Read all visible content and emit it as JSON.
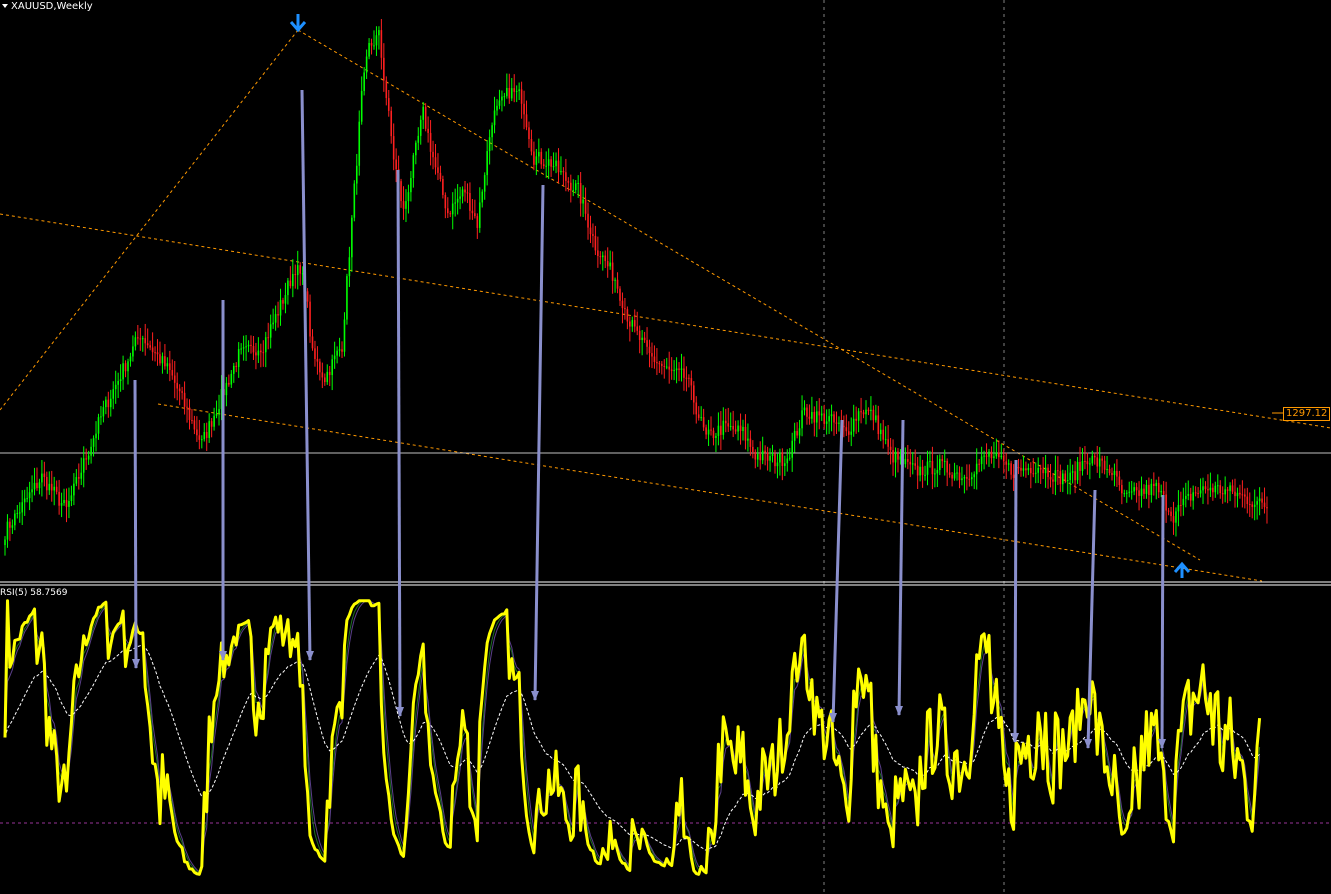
{
  "window": {
    "symbol_label": "XAUUSD,Weekly",
    "indicator_label": "RSI(5) 58.7569",
    "price_tag": "1297.12"
  },
  "colors": {
    "background": "#000000",
    "bull_candle": "#00ff00",
    "bear_candle": "#ff2020",
    "trendline": "#ff9900",
    "divergence_arrow": "#8a8fcc",
    "rsi_line": "#ffff00",
    "rsi_signal": "#ffffff",
    "level_line": "#993399",
    "fractal_marker": "#1e90ff",
    "separator": "#ffffff"
  },
  "icons": {
    "top_marker": "arrow-down-icon",
    "bottom_marker": "arrow-up-icon"
  },
  "chart_data": [
    {
      "type": "candlestick",
      "panel": "price",
      "symbol": "XAUUSD",
      "timeframe": "Weekly",
      "current_price": 1297.12,
      "grid": false,
      "swing_points_close": [
        [
          0,
          1160
        ],
        [
          15,
          1210
        ],
        [
          25,
          1180
        ],
        [
          40,
          1270
        ],
        [
          55,
          1340
        ],
        [
          67,
          1305
        ],
        [
          80,
          1240
        ],
        [
          95,
          1320
        ],
        [
          105,
          1330
        ],
        [
          112,
          1365
        ],
        [
          118,
          1400
        ],
        [
          122,
          1385
        ],
        [
          125,
          1320
        ],
        [
          130,
          1300
        ],
        [
          137,
          1330
        ],
        [
          145,
          1555
        ],
        [
          148,
          1600
        ],
        [
          152,
          1610
        ],
        [
          158,
          1500
        ],
        [
          162,
          1450
        ],
        [
          170,
          1540
        ],
        [
          175,
          1490
        ],
        [
          180,
          1450
        ],
        [
          187,
          1470
        ],
        [
          192,
          1440
        ],
        [
          198,
          1535
        ],
        [
          205,
          1560
        ],
        [
          210,
          1555
        ],
        [
          215,
          1500
        ],
        [
          222,
          1495
        ],
        [
          228,
          1480
        ],
        [
          233,
          1470
        ],
        [
          240,
          1420
        ],
        [
          248,
          1390
        ],
        [
          254,
          1350
        ],
        [
          262,
          1320
        ],
        [
          270,
          1305
        ],
        [
          277,
          1300
        ],
        [
          285,
          1245
        ],
        [
          292,
          1255
        ],
        [
          300,
          1250
        ],
        [
          305,
          1230
        ],
        [
          313,
          1225
        ],
        [
          318,
          1228
        ],
        [
          325,
          1270
        ],
        [
          330,
          1265
        ],
        [
          335,
          1262
        ],
        [
          342,
          1250
        ],
        [
          348,
          1272
        ],
        [
          353,
          1265
        ],
        [
          360,
          1230
        ],
        [
          370,
          1215
        ],
        [
          380,
          1220
        ],
        [
          390,
          1210
        ],
        [
          400,
          1230
        ],
        [
          410,
          1215
        ],
        [
          420,
          1220
        ],
        [
          428,
          1210
        ],
        [
          433,
          1208
        ],
        [
          440,
          1228
        ],
        [
          450,
          1215
        ],
        [
          455,
          1190
        ],
        [
          460,
          1195
        ],
        [
          468,
          1200
        ],
        [
          475,
          1175
        ],
        [
          483,
          1195
        ],
        [
          490,
          1200
        ],
        [
          500,
          1195
        ],
        [
          510,
          1185
        ],
        [
          520,
          1180
        ]
      ]
    },
    {
      "type": "line",
      "panel": "indicator",
      "title": "RSI(5) 58.7569",
      "ylim": [
        0,
        100
      ],
      "last_value": 58.7569,
      "level": 20,
      "series": [
        {
          "name": "RSI(5)",
          "style": "yellow"
        },
        {
          "style": "dotted white"
        },
        {
          "style": "thin green"
        },
        {
          "style": "thin purple"
        }
      ]
    }
  ]
}
